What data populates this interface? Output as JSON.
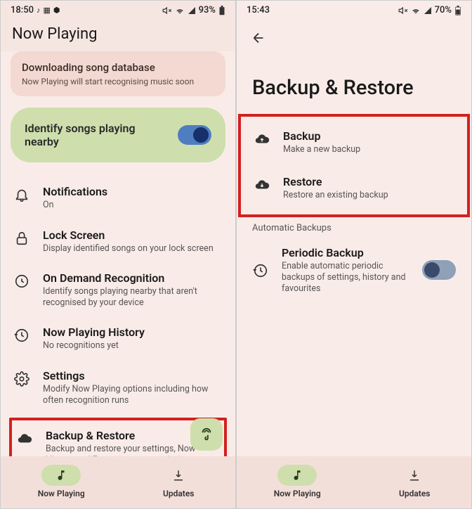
{
  "left": {
    "status": {
      "time": "18:50",
      "battery": "93%"
    },
    "header": "Now Playing",
    "download": {
      "title": "Downloading song database",
      "sub": "Now Playing will start recognising music soon"
    },
    "toggle": {
      "label": "Identify songs playing nearby"
    },
    "items": [
      {
        "title": "Notifications",
        "sub": "On"
      },
      {
        "title": "Lock Screen",
        "sub": "Display identified songs on your lock screen"
      },
      {
        "title": "On Demand Recognition",
        "sub": "Identify songs playing nearby that aren't recognised by your device"
      },
      {
        "title": "Now Playing History",
        "sub": "No recognitions yet"
      },
      {
        "title": "Settings",
        "sub": "Modify Now Playing options including how often recognition runs"
      },
      {
        "title": "Backup & Restore",
        "sub": "Backup and restore your settings, Now History and Favourites to your device or cloud"
      }
    ],
    "nav": {
      "now_playing": "Now Playing",
      "updates": "Updates"
    }
  },
  "right": {
    "status": {
      "time": "15:43",
      "battery": "70%"
    },
    "title": "Backup & Restore",
    "backup": {
      "title": "Backup",
      "sub": "Make a new backup"
    },
    "restore": {
      "title": "Restore",
      "sub": "Restore an existing backup"
    },
    "section": "Automatic Backups",
    "periodic": {
      "title": "Periodic Backup",
      "sub": "Enable automatic periodic backups of settings, history and favourites"
    },
    "nav": {
      "now_playing": "Now Playing",
      "updates": "Updates"
    }
  }
}
